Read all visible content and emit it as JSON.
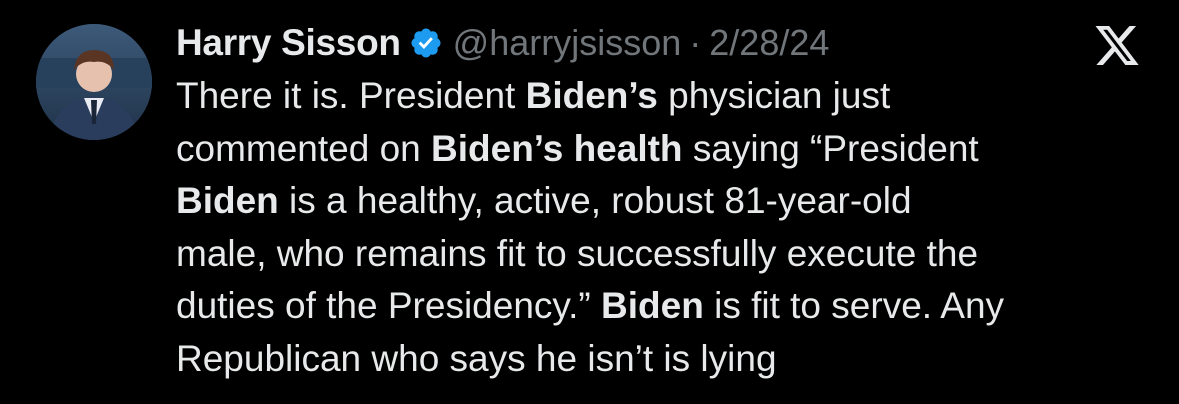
{
  "tweet": {
    "display_name": "Harry Sisson",
    "handle": "@harryjsisson",
    "separator": "·",
    "date": "2/28/24",
    "verified": true,
    "verified_color": "#1d9bf0",
    "text_color": "#e7e9ea",
    "muted_color": "#71767b",
    "background_color": "#000000",
    "body_lines": [
      [
        {
          "t": "There it is. President ",
          "b": false
        },
        {
          "t": "Biden’s",
          "b": true
        },
        {
          "t": " physician just",
          "b": false
        }
      ],
      [
        {
          "t": "commented on ",
          "b": false
        },
        {
          "t": "Biden’s health",
          "b": true
        },
        {
          "t": " saying “President",
          "b": false
        }
      ],
      [
        {
          "t": "Biden",
          "b": true
        },
        {
          "t": " is a healthy, active, robust 81-year-old",
          "b": false
        }
      ],
      [
        {
          "t": "male, who remains fit to successfully execute the",
          "b": false
        }
      ],
      [
        {
          "t": "duties of the Presidency.” ",
          "b": false
        },
        {
          "t": "Biden",
          "b": true
        },
        {
          "t": " is fit to serve. Any",
          "b": false
        }
      ],
      [
        {
          "t": "Republican who says he isn’t is lying",
          "b": false
        }
      ]
    ]
  },
  "icons": {
    "avatar": "profile-photo",
    "verified": "verified-badge-icon",
    "brand": "x-logo-icon"
  }
}
